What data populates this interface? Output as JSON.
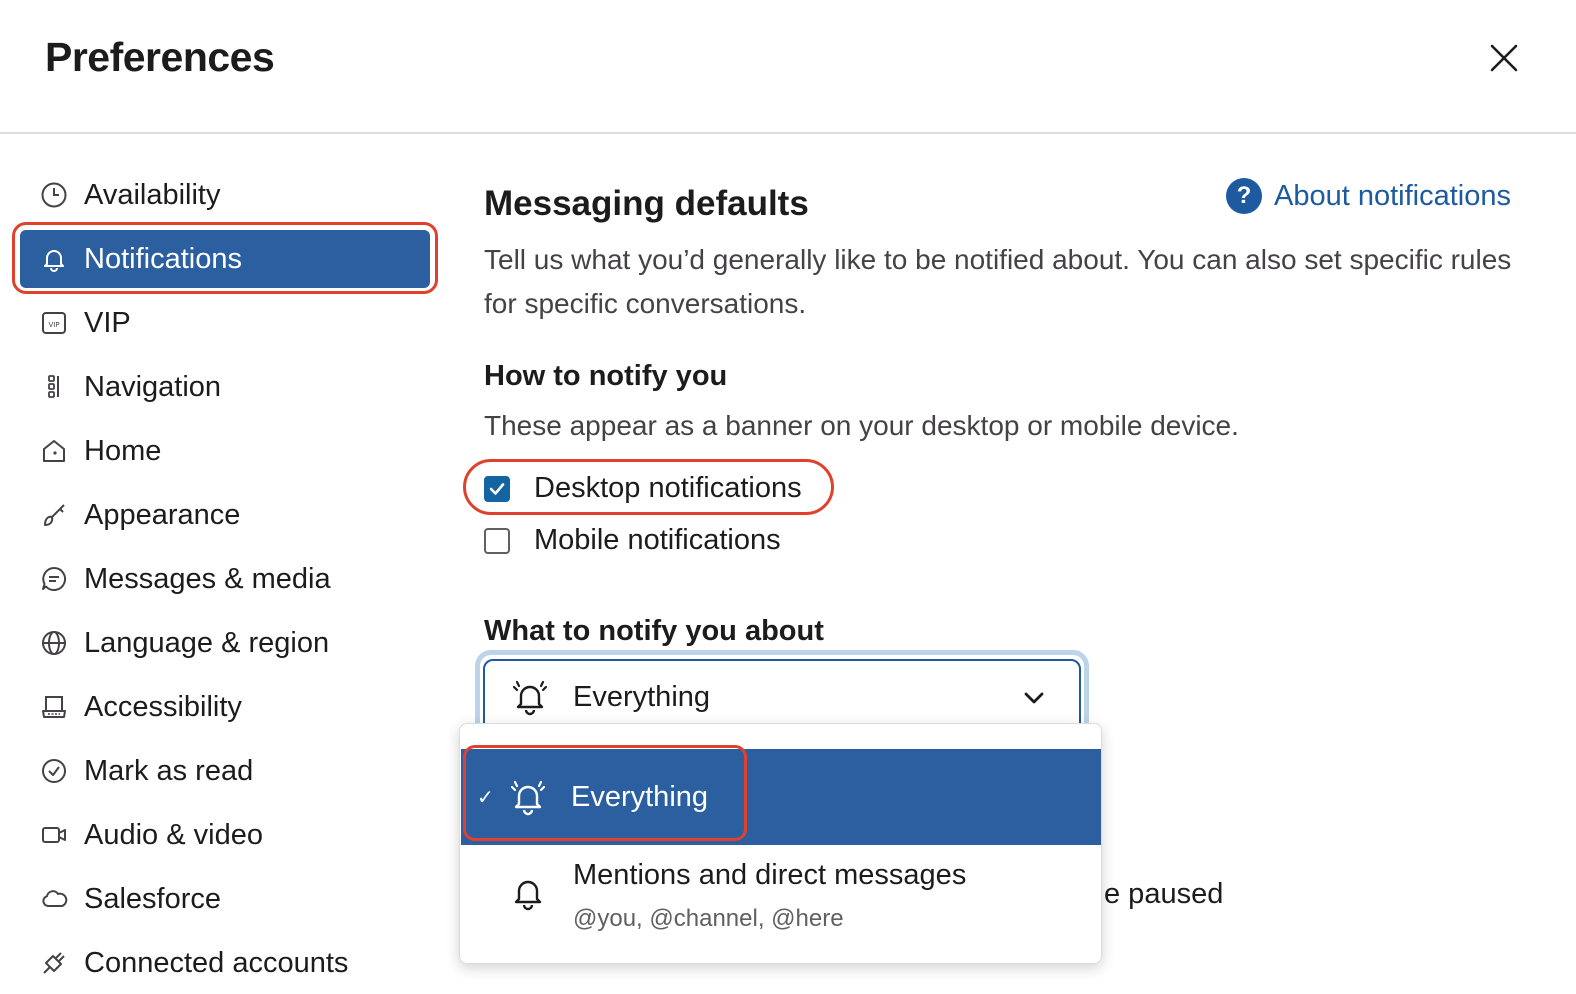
{
  "header": {
    "title": "Preferences"
  },
  "sidebar": {
    "items": [
      {
        "label": "Availability",
        "icon": "clock-icon"
      },
      {
        "label": "Notifications",
        "icon": "bell-icon",
        "active": true
      },
      {
        "label": "VIP",
        "icon": "vip-icon"
      },
      {
        "label": "Navigation",
        "icon": "navigation-icon"
      },
      {
        "label": "Home",
        "icon": "home-icon"
      },
      {
        "label": "Appearance",
        "icon": "brush-icon"
      },
      {
        "label": "Messages & media",
        "icon": "message-icon"
      },
      {
        "label": "Language & region",
        "icon": "globe-icon"
      },
      {
        "label": "Accessibility",
        "icon": "keyboard-icon"
      },
      {
        "label": "Mark as read",
        "icon": "check-circle-icon"
      },
      {
        "label": "Audio & video",
        "icon": "video-icon"
      },
      {
        "label": "Salesforce",
        "icon": "cloud-icon"
      },
      {
        "label": "Connected accounts",
        "icon": "plug-icon"
      }
    ]
  },
  "main": {
    "heading": "Messaging defaults",
    "about_link": "About notifications",
    "description": "Tell us what you’d generally like to be notified about. You can also set specific rules for specific conversations.",
    "how_heading": "How to notify you",
    "how_sub": "These appear as a banner on your desktop or mobile device.",
    "desktop_label": "Desktop notifications",
    "desktop_checked": true,
    "mobile_label": "Mobile notifications",
    "mobile_checked": false,
    "what_heading": "What to notify you about",
    "select_value": "Everything",
    "options": [
      {
        "label": "Everything",
        "selected": true
      },
      {
        "label": "Mentions and direct messages",
        "sublabel": "@you, @channel, @here"
      }
    ],
    "behind_text": "e paused"
  },
  "colors": {
    "accent": "#2c5fa0",
    "highlight": "#e0412c",
    "link": "#1d5aa0"
  }
}
